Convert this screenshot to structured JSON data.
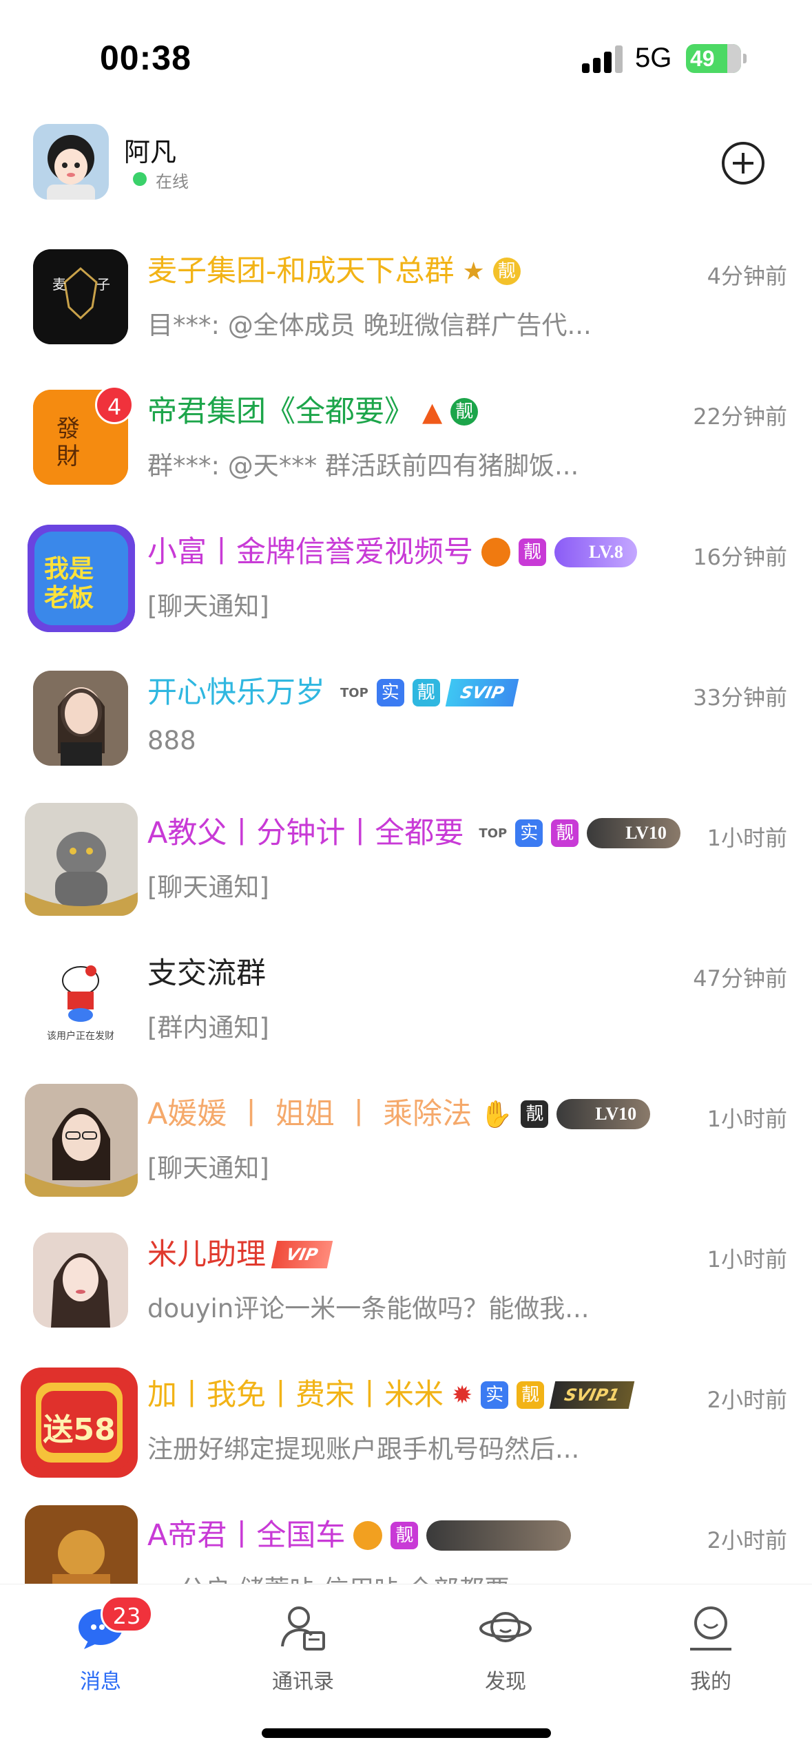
{
  "status": {
    "time": "00:38",
    "network": "5G",
    "battery": "49"
  },
  "profile": {
    "name": "阿凡",
    "status": "在线"
  },
  "chats": [
    {
      "name": "麦子集团-和成天下总群",
      "name_color": "#f2b316",
      "preview": "目***: @全体成员 晚班微信群广告代...",
      "time": "4分钟前",
      "badges": [
        "party-icon",
        "靓"
      ],
      "avatar_color": "#111111",
      "avatar_text": "麦 子"
    },
    {
      "name": "帝君集团《全都要》",
      "name_color": "#1ca54a",
      "preview": "群***: @天***  群活跃前四有猪脚饭...",
      "time": "22分钟前",
      "unread": "4",
      "badges": [
        "fire-icon",
        "靓"
      ],
      "avatar_color": "#f58b10",
      "avatar_text": "發財"
    },
    {
      "name": "小富丨金牌信誉爱视频号",
      "name_color": "#c83ad6",
      "preview": "[聊天通知]",
      "time": "16分钟前",
      "badges": [
        "pumpkin-icon",
        "靓",
        "LV.8"
      ],
      "avatar_color": "#5b3bd6",
      "avatar_text": "我是老板"
    },
    {
      "name": "开心快乐万岁",
      "name_color": "#2fb7e0",
      "preview": "888",
      "time": "33分钟前",
      "badges": [
        "TOP",
        "实",
        "靓",
        "SVIP"
      ],
      "avatar_color": "#9a8a78",
      "avatar_text": ""
    },
    {
      "name": "A教父丨分钟计丨全都要",
      "name_color": "#c83ad6",
      "preview": "[聊天通知]",
      "time": "1小时前",
      "badges": [
        "TOP",
        "实",
        "靓",
        "LV10"
      ],
      "avatar_color": "#cfcfcf",
      "avatar_text": ""
    },
    {
      "name": "支交流群",
      "name_color": "#222222",
      "preview": "[群内通知]",
      "time": "47分钟前",
      "badges": [],
      "avatar_color": "#ffffff",
      "avatar_text": "该用户正在发财"
    },
    {
      "name": "A媛媛 丨 姐姐 丨 乘除法",
      "name_color": "#f5a96b",
      "preview": "[聊天通知]",
      "time": "1小时前",
      "badges": [
        "wave-icon",
        "靓",
        "LV10"
      ],
      "avatar_color": "#c9b8a8",
      "avatar_text": ""
    },
    {
      "name": "米儿助理",
      "name_color": "#e0392d",
      "preview": "douyin评论一米一条能做吗？能做我...",
      "time": "1小时前",
      "badges": [
        "VIP"
      ],
      "avatar_color": "#d9c8c0",
      "avatar_text": ""
    },
    {
      "name": "加丨我免丨费宋丨米米",
      "name_color": "#f2b316",
      "preview": "注册好绑定提现账户跟手机号码然后...",
      "time": "2小时前",
      "badges": [
        "anger-icon",
        "实",
        "靓",
        "SVIP1"
      ],
      "avatar_color": "#e0312c",
      "avatar_text": "送58"
    },
    {
      "name": "A帝君丨全国车",
      "name_color": "#c83ad6",
      "preview": "▬ 公户 储蓄咔 信用咔 全部都要",
      "time": "2小时前",
      "badges": [
        "lion-icon",
        "靓",
        "rank"
      ],
      "avatar_color": "#a0662a",
      "avatar_text": ""
    }
  ],
  "tabs": [
    {
      "label": "消息",
      "icon": "chat-bubble-icon",
      "badge": "23",
      "active": true
    },
    {
      "label": "通讯录",
      "icon": "contacts-icon",
      "active": false
    },
    {
      "label": "发现",
      "icon": "planet-icon",
      "active": false
    },
    {
      "label": "我的",
      "icon": "profile-face-icon",
      "active": false
    }
  ],
  "colors": {
    "accent": "#2b6cf5",
    "unread": "#f0323c",
    "online": "#3ad16a"
  }
}
